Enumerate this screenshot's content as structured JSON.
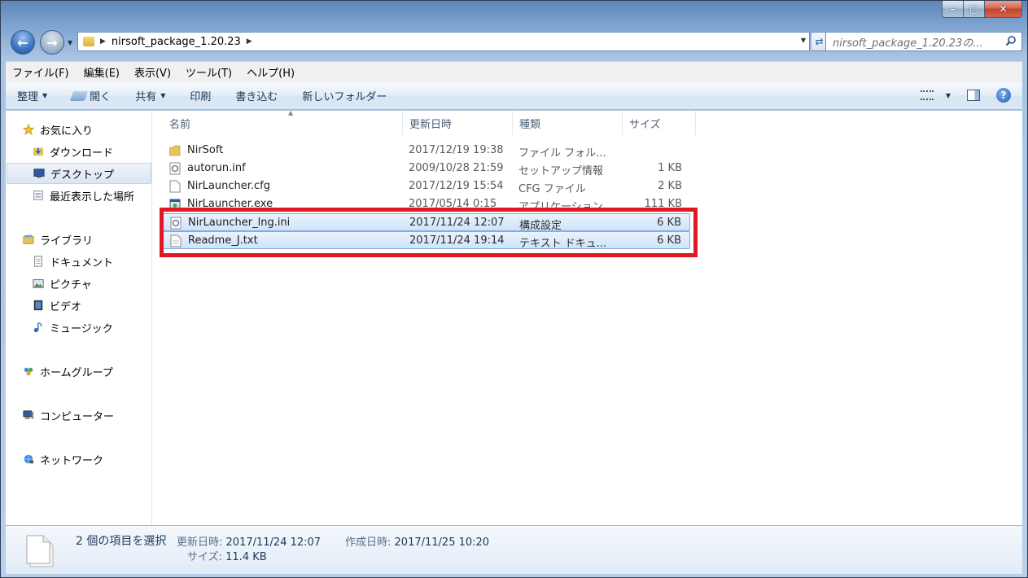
{
  "window": {
    "caption_min": "–",
    "caption_max": "□",
    "caption_close": "✕"
  },
  "address": {
    "path_segment": "nirsoft_package_1.20.23",
    "search_placeholder": "nirsoft_package_1.20.23の..."
  },
  "menu": [
    "ファイル(F)",
    "編集(E)",
    "表示(V)",
    "ツール(T)",
    "ヘルプ(H)"
  ],
  "commands": {
    "organize": "整理",
    "open": "開く",
    "share": "共有",
    "print": "印刷",
    "burn": "書き込む",
    "new_folder": "新しいフォルダー"
  },
  "nav": {
    "favorites": "お気に入り",
    "downloads": "ダウンロード",
    "desktop": "デスクトップ",
    "recent": "最近表示した場所",
    "libraries": "ライブラリ",
    "documents": "ドキュメント",
    "pictures": "ピクチャ",
    "videos": "ビデオ",
    "music": "ミュージック",
    "homegroup": "ホームグループ",
    "computer": "コンピューター",
    "network": "ネットワーク"
  },
  "columns": {
    "name": "名前",
    "date": "更新日時",
    "type": "種類",
    "size": "サイズ"
  },
  "files": [
    {
      "name": "NirSoft",
      "date": "2017/12/19 19:38",
      "type": "ファイル フォル...",
      "size": "",
      "icon": "folder-icon",
      "selected": false
    },
    {
      "name": "autorun.inf",
      "date": "2009/10/28 21:59",
      "type": "セットアップ情報",
      "size": "1 KB",
      "icon": "settings-file-icon",
      "selected": false
    },
    {
      "name": "NirLauncher.cfg",
      "date": "2017/12/19 15:54",
      "type": "CFG ファイル",
      "size": "2 KB",
      "icon": "blank-file-icon",
      "selected": false
    },
    {
      "name": "NirLauncher.exe",
      "date": "2017/05/14 0:15",
      "type": "アプリケーション",
      "size": "111 KB",
      "icon": "application-icon",
      "selected": false
    },
    {
      "name": "NirLauncher_lng.ini",
      "date": "2017/11/24 12:07",
      "type": "構成設定",
      "size": "6 KB",
      "icon": "settings-file-icon",
      "selected": true
    },
    {
      "name": "Readme_J.txt",
      "date": "2017/11/24 19:14",
      "type": "テキスト ドキュ...",
      "size": "6 KB",
      "icon": "text-file-icon",
      "selected": true
    }
  ],
  "details": {
    "title": "2 個の項目を選択",
    "modified_label": "更新日時:",
    "modified_value": "2017/11/24 12:07",
    "created_label": "作成日時:",
    "created_value": "2017/11/25 10:20",
    "size_label": "サイズ:",
    "size_value": "11.4 KB"
  },
  "colors": {
    "highlight_box": "#e01824",
    "selection": "#cfe3fb"
  }
}
